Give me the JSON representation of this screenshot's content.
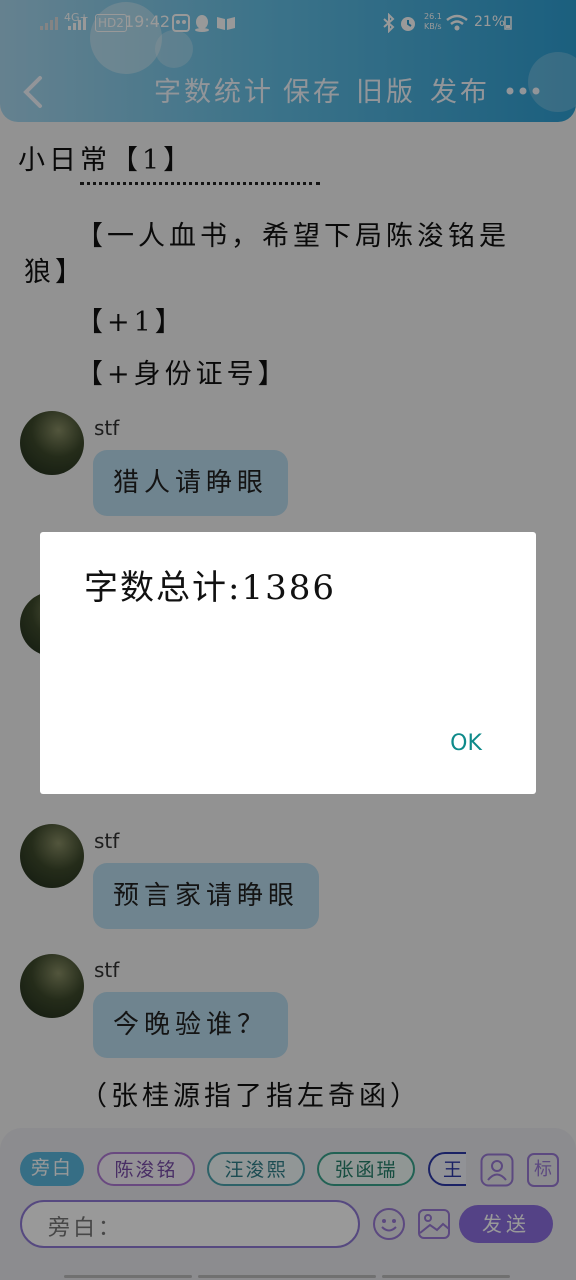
{
  "status_bar": {
    "network": "4G+",
    "hd": "HD2",
    "time": "19:42",
    "speed": "26.1 KB/s",
    "battery": "21%"
  },
  "header": {
    "menu": [
      "字数统计",
      "保存",
      "旧版",
      "发布"
    ]
  },
  "content": {
    "title": "小日常【1】",
    "lines": [
      "【一人血书，希望下局陈浚铭是",
      "狼】",
      "【+1】",
      "【+身份证号】"
    ],
    "messages": [
      {
        "user": "stf",
        "text": "猎人请睁眼"
      },
      {
        "user": "stf",
        "text": "预言家请睁眼"
      },
      {
        "user": "stf",
        "text": "今晚验谁？"
      }
    ],
    "narration": "（张桂源指了指左奇函）"
  },
  "bottom": {
    "chips": [
      "旁白",
      "陈浚铭",
      "汪浚熙",
      "张函瑞",
      "王"
    ],
    "input_placeholder": "旁白：",
    "send_label": "发送",
    "tag_label": "标"
  },
  "dialog": {
    "message": "字数总计:1386",
    "ok_label": "OK"
  },
  "colors": {
    "header_start": "#a9d8ef",
    "header_end": "#2e9fd3",
    "bubble": "#b9dcee",
    "accent": "#8d6fe0",
    "ok": "#0e8a8a"
  },
  "icons": [
    "back-icon",
    "more-icon",
    "person-icon",
    "emoji-icon",
    "image-icon"
  ]
}
